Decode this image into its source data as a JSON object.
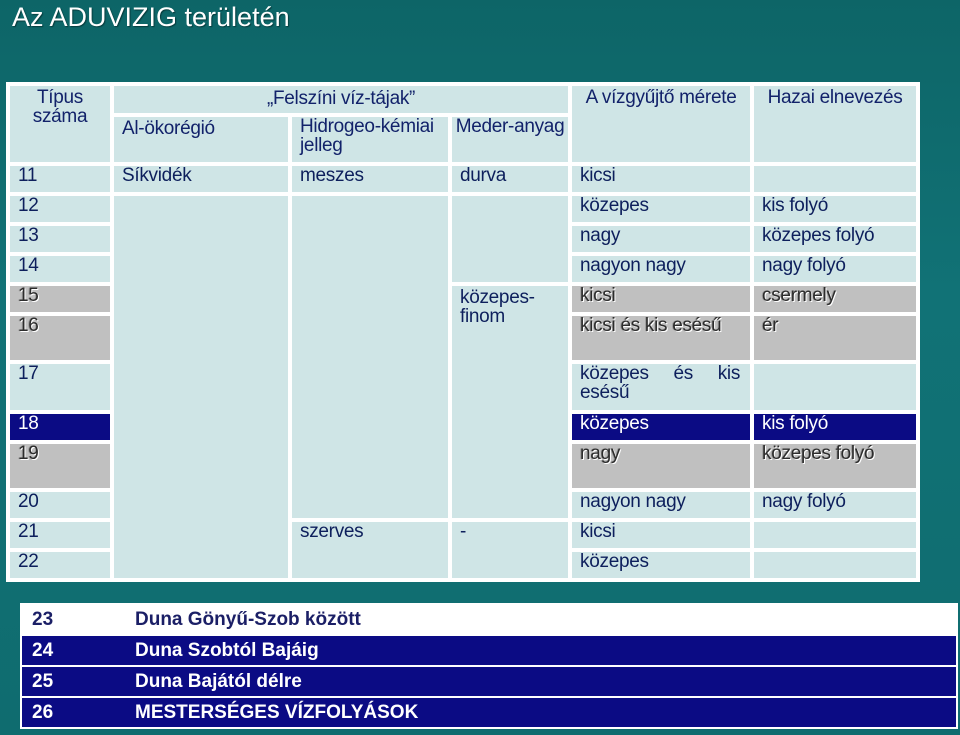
{
  "title": "Az ADUVIZIG területén",
  "header": {
    "tipus": "Típus száma",
    "felszini": "„Felszíni víz-tájak”",
    "al_okoregio": "Al-ökorégió",
    "hidrogeo": "Hidrogeo-kémiai jelleg",
    "mederanyag": "Meder-anyag",
    "vizgyujto": "A vízgyűjtő mérete",
    "hazai": "Hazai elnevezés"
  },
  "rows": [
    {
      "num": "11",
      "okoregio": "Síkvidék",
      "hidro": "meszes",
      "meder": "durva",
      "meret": "kicsi",
      "nev": ""
    },
    {
      "num": "12",
      "okoregio": "",
      "hidro": "",
      "meder": "",
      "meret": "közepes",
      "nev": "kis folyó"
    },
    {
      "num": "13",
      "okoregio": "",
      "hidro": "",
      "meder": "",
      "meret": "nagy",
      "nev": "közepes folyó"
    },
    {
      "num": "14",
      "okoregio": "",
      "hidro": "",
      "meder": "",
      "meret": "nagyon nagy",
      "nev": "nagy folyó"
    },
    {
      "num": "15",
      "okoregio": "",
      "hidro": "",
      "meder": "közepes-finom",
      "meret": "kicsi",
      "nev": "csermely"
    },
    {
      "num": "16",
      "okoregio": "",
      "hidro": "",
      "meder": "",
      "meret": "kicsi és kis esésű",
      "nev": "ér"
    },
    {
      "num": "17",
      "okoregio": "",
      "hidro": "",
      "meder": "",
      "meret": "közepes és kis esésű",
      "nev": ""
    },
    {
      "num": "18",
      "okoregio": "",
      "hidro": "",
      "meder": "",
      "meret": "közepes",
      "nev": "kis folyó"
    },
    {
      "num": "19",
      "okoregio": "",
      "hidro": "",
      "meder": "",
      "meret": "nagy",
      "nev": "közepes folyó"
    },
    {
      "num": "20",
      "okoregio": "",
      "hidro": "",
      "meder": "",
      "meret": "nagyon nagy",
      "nev": "nagy folyó"
    },
    {
      "num": "21",
      "okoregio": "",
      "hidro": "szerves",
      "meder": "-",
      "meret": "kicsi",
      "nev": ""
    },
    {
      "num": "22",
      "okoregio": "",
      "hidro": "",
      "meder": "",
      "meret": "közepes",
      "nev": ""
    }
  ],
  "extra": [
    {
      "num": "23",
      "label": "Duna Gönyű-Szob között"
    },
    {
      "num": "24",
      "label": "Duna Szobtól Bajáig"
    },
    {
      "num": "25",
      "label": "Duna Bajától délre"
    },
    {
      "num": "26",
      "label": "MESTERSÉGES VÍZFOLYÁSOK"
    }
  ]
}
